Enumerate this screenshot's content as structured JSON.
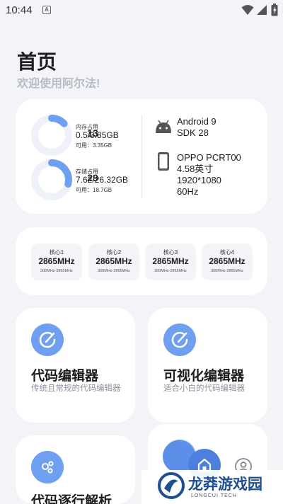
{
  "status_bar": {
    "time": "10:44",
    "notification_letter": "A",
    "icons": [
      "wifi-icon",
      "signal-icon",
      "battery-icon"
    ]
  },
  "header": {
    "title": "首页",
    "subtitle": "欢迎使用阿尔法!"
  },
  "info_card": {
    "memory": {
      "percent": "13",
      "percent_fraction": 0.13,
      "label": "内存占用",
      "value": "0.5/3.85GB",
      "available": "可用：3.35GB"
    },
    "storage": {
      "percent": "29",
      "percent_fraction": 0.29,
      "label": "存储占用",
      "value": "7.62/26.32GB",
      "available": "可用：18.7GB"
    },
    "system": {
      "icon": "android-icon",
      "android": "Android 9",
      "sdk": "SDK 28"
    },
    "device": {
      "icon": "phone-icon",
      "model": "OPPO PCRT00",
      "screen_size": "4.58英寸",
      "resolution": "1920*1080",
      "refresh_rate": "60Hz"
    }
  },
  "cpu_cores": [
    {
      "name": "核心1",
      "freq": "2865MHz",
      "range": "300MHz-2865MHz"
    },
    {
      "name": "核心2",
      "freq": "2865MHz",
      "range": "300MHz-2865MHz"
    },
    {
      "name": "核心3",
      "freq": "2865MHz",
      "range": "300MHz-2865MHz"
    },
    {
      "name": "核心4",
      "freq": "2865MHz",
      "range": "300MHz-2865MHz"
    }
  ],
  "features": [
    {
      "title": "代码编辑器",
      "desc": "传统且常规的代码编辑器",
      "icon": "edit-icon"
    },
    {
      "title": "可视化编辑器",
      "desc": "适合小白的代码编辑器",
      "icon": "edit-icon"
    },
    {
      "title": "代码逐行解析",
      "icon": "bubbles-icon"
    },
    {
      "icon": "lightning-icon"
    }
  ],
  "floating_buttons": {
    "main_icon": "home-icon",
    "secondary_icon": "user-icon"
  },
  "watermark": {
    "brand": "龙莽游戏园",
    "sub": "LONGCUI.TECH",
    "accent_color": "#1f4f8f"
  },
  "colors": {
    "accent": "#6f9ff0",
    "background": "#f3f4f8",
    "card": "#ffffff"
  }
}
